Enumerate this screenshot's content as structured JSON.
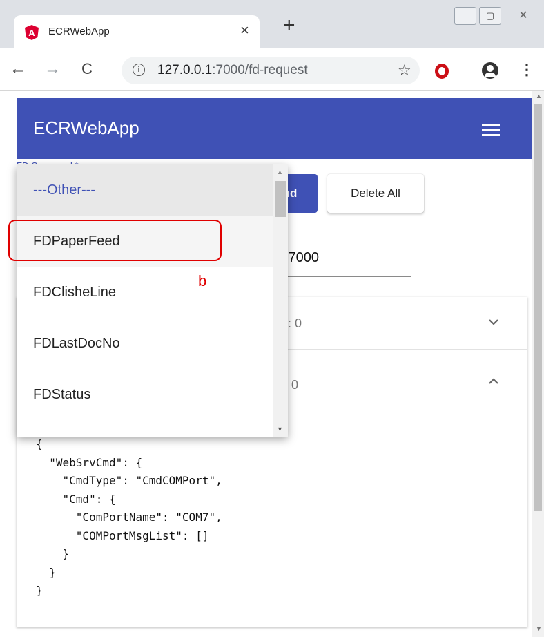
{
  "browser": {
    "tab_title": "ECRWebApp",
    "tab_close": "×",
    "new_tab": "+",
    "url_host": "127.0.0.1",
    "url_rest": ":7000/fd-request",
    "nav": {
      "back": "←",
      "forward": "→",
      "reload": "C"
    },
    "star": "☆",
    "menu": "⋮",
    "info": "i",
    "window_controls": [
      "–",
      "▢",
      "✕"
    ]
  },
  "app": {
    "title": "ECRWebApp",
    "field_label": "FD Command *",
    "send_button": "nd",
    "delete_button": "Delete All",
    "port_value": ":7000",
    "panel1_count": "t: 0",
    "panel2_count": ": 0",
    "json_preview": "{\n  \"WebSrvCmd\": {\n    \"CmdType\": \"CmdCOMPort\",\n    \"Cmd\": {\n      \"ComPortName\": \"COM7\",\n      \"COMPortMsgList\": []\n    }\n  }\n}"
  },
  "dropdown": {
    "options": [
      "---Other---",
      "FDPaperFeed",
      "FDClisheLine",
      "FDLastDocNo",
      "FDStatus"
    ],
    "selected_index": 0,
    "hovered_index": 1
  },
  "annotation": {
    "label": "b",
    "color": "#e00000"
  },
  "colors": {
    "primary": "#3f51b5",
    "angular_red": "#dd0031"
  },
  "icons": {
    "favicon": "angular-icon",
    "chevron_down": "⌄",
    "chevron_up": "⌃"
  }
}
